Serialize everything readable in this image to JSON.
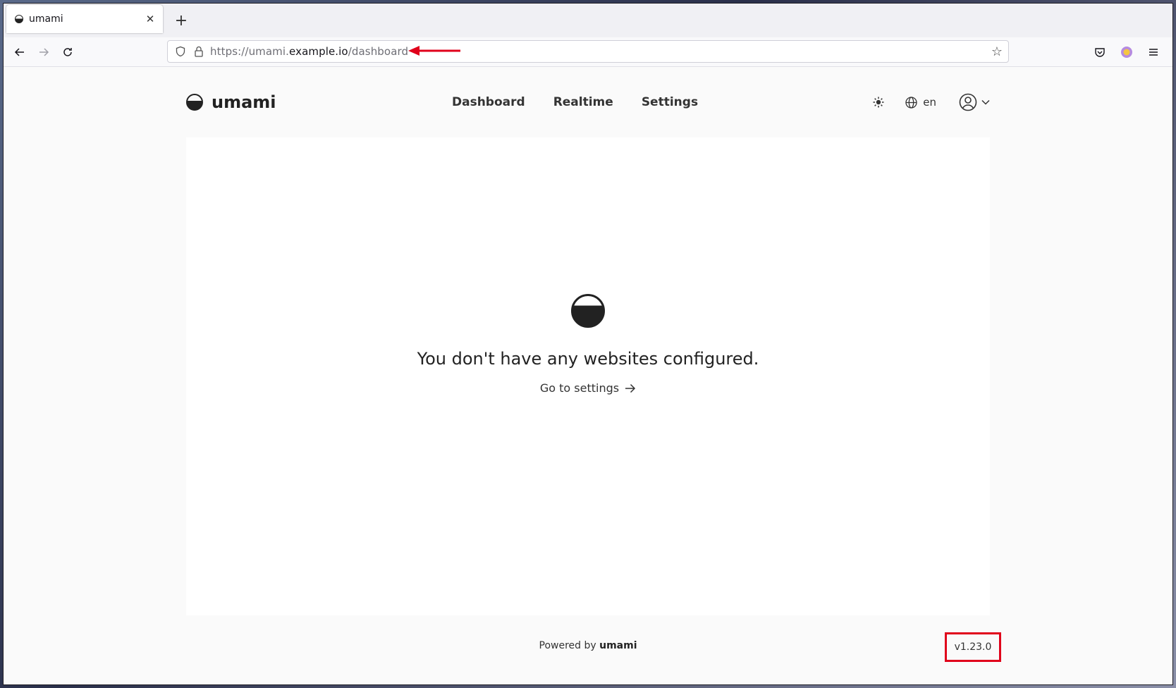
{
  "browser": {
    "tab_title": "umami",
    "url_base": "https://umami.",
    "url_host": "example.io",
    "url_path": "/dashboard"
  },
  "app": {
    "logo_text": "umami",
    "nav": [
      "Dashboard",
      "Realtime",
      "Settings"
    ],
    "language": "en"
  },
  "empty_state": {
    "message": "You don't have any websites configured.",
    "link_label": "Go to settings"
  },
  "footer": {
    "powered_prefix": "Powered by",
    "powered_brand": "umami",
    "version": "v1.23.0"
  },
  "colors": {
    "annotation_red": "#e0001b"
  }
}
